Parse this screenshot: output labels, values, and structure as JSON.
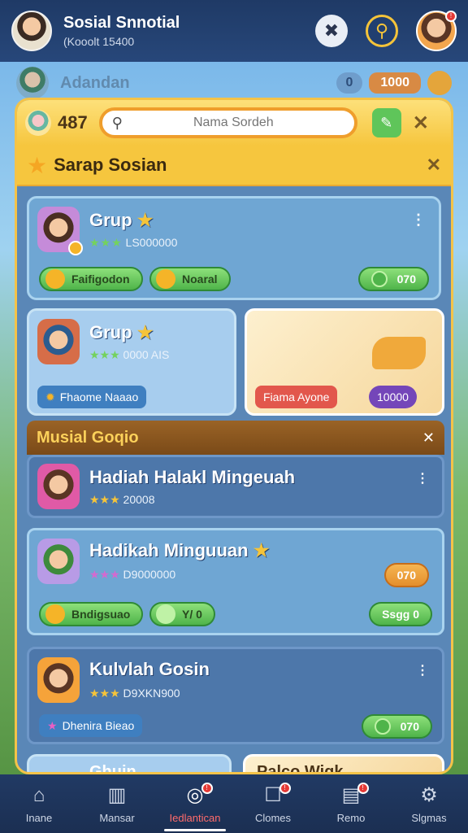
{
  "header": {
    "title": "Sosial Snnotial",
    "subtitle": "(Kooolt 15400",
    "icons": [
      "tools-icon",
      "search-icon",
      "profile-avatar"
    ],
    "profile_badge": "!"
  },
  "background_strip": {
    "label": "Adandan",
    "value_a": "0",
    "value_b": "1000"
  },
  "panel": {
    "level": "487",
    "search": {
      "placeholder": "Nama Sordeh",
      "value": ""
    },
    "section_title": "Sarap Sosian",
    "cards": [
      {
        "name": "Grup",
        "meta": "LS000000",
        "stars": "★★★",
        "pill_a": "Faifigodon",
        "pill_b": "Noaral",
        "value": "070"
      }
    ],
    "tiles": {
      "left_name": "Grup",
      "left_meta": "0000 AIS",
      "left_stars": "★★★",
      "left_chip": "Fhaome Naaao",
      "right_chip_a": "Fiama Ayone",
      "right_chip_b": "10000"
    },
    "sub_section_title": "Musial Goqio",
    "rows": [
      {
        "name": "Hadiah Halakl Mingeuah",
        "meta": "20008",
        "stars": "★★★"
      },
      {
        "name": "Hadikah Minguuan",
        "meta": "D9000000",
        "stars": "★★★",
        "pill_a": "Bndigsuao",
        "pill_b": "Y/ 0",
        "value": "070",
        "right_btn": "Ssgg 0"
      },
      {
        "name": "Kulvlah Gosin",
        "meta": "D9XKN900",
        "stars": "★★★",
        "chip": "Dhenira Bieao",
        "value": "070"
      }
    ],
    "peek": {
      "left": "Ghuin",
      "right": "Palco Wigk"
    }
  },
  "bottom_nav": [
    {
      "label": "Inane",
      "icon": "home-icon"
    },
    {
      "label": "Mansar",
      "icon": "chart-icon"
    },
    {
      "label": "Iedlantican",
      "icon": "search-notification-icon",
      "badge": "!"
    },
    {
      "label": "Clomes",
      "icon": "message-icon",
      "badge": "!"
    },
    {
      "label": "Remo",
      "icon": "inbox-icon",
      "badge": "!"
    },
    {
      "label": "Slgmas",
      "icon": "settings-icon"
    }
  ]
}
